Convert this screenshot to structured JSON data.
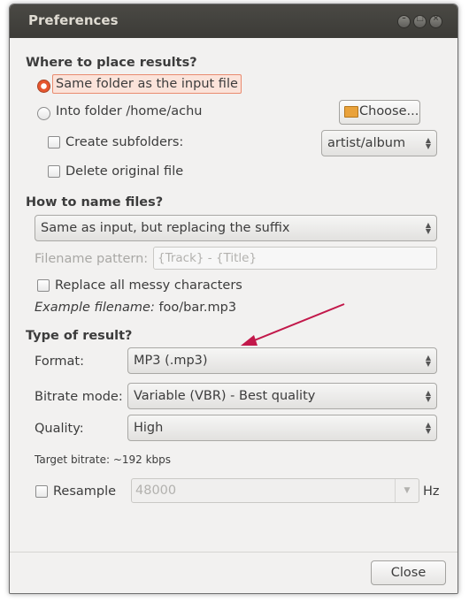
{
  "window": {
    "title": "Preferences"
  },
  "placement": {
    "heading": "Where to place results?",
    "same_folder_label": "Same folder as the input file",
    "into_folder_label": "Into folder /home/achu",
    "choose_label": "Choose...",
    "create_subfolders_label": "Create subfolders:",
    "subfolder_value": "artist/album",
    "delete_original_label": "Delete original file"
  },
  "naming": {
    "heading": "How to name files?",
    "scheme_value": "Same as input, but replacing the suffix",
    "pattern_label": "Filename pattern:",
    "pattern_value": "{Track} - {Title}",
    "replace_messy_label": "Replace all messy characters",
    "example_prefix": "Example filename:",
    "example_value": " foo/bar.mp3"
  },
  "result": {
    "heading": "Type of result?",
    "format_label": "Format:",
    "format_value": "MP3 (.mp3)",
    "bitrate_mode_label": "Bitrate mode:",
    "bitrate_mode_value": "Variable (VBR) - Best quality",
    "quality_label": "Quality:",
    "quality_value": "High",
    "target_bitrate": "Target bitrate: ~192 kbps",
    "resample_label": "Resample",
    "resample_value": "48000",
    "hz_label": "Hz"
  },
  "footer": {
    "close_label": "Close"
  },
  "colors": {
    "accent": "#e6562f",
    "annotation_arrow": "#c2184a"
  }
}
